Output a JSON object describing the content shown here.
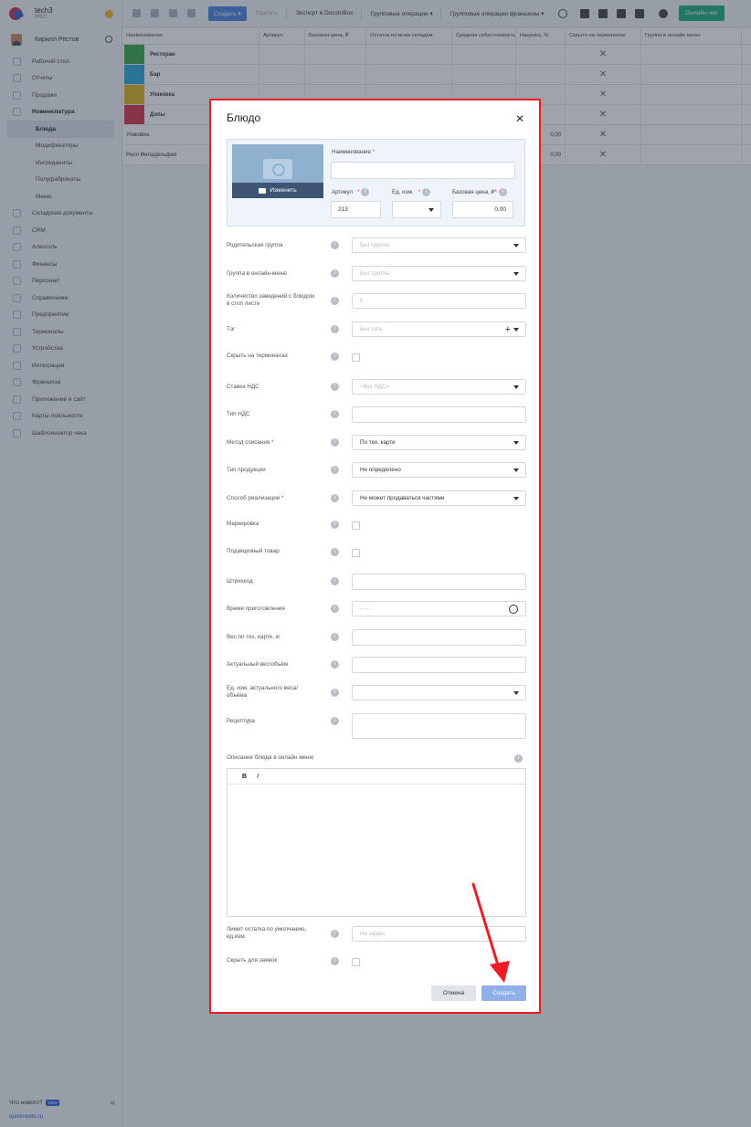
{
  "brand": {
    "name": "tech3",
    "plan": "PRO"
  },
  "user": {
    "name": "Кирилл Рестов"
  },
  "sidebar": {
    "items": [
      {
        "label": "Рабочий стол",
        "type": "top"
      },
      {
        "label": "Отчеты",
        "type": "top"
      },
      {
        "label": "Продажи",
        "type": "top"
      },
      {
        "label": "Номенклатура",
        "type": "open"
      },
      {
        "label": "Блюда",
        "type": "active"
      },
      {
        "label": "Модификаторы",
        "type": "sub"
      },
      {
        "label": "Ингредиенты",
        "type": "sub"
      },
      {
        "label": "Полуфабрикаты",
        "type": "sub"
      },
      {
        "label": "Меню",
        "type": "sub"
      },
      {
        "label": "Складские документы",
        "type": "top"
      },
      {
        "label": "CRM",
        "type": "top"
      },
      {
        "label": "Алкоголь",
        "type": "top"
      },
      {
        "label": "Финансы",
        "type": "top"
      },
      {
        "label": "Персонал",
        "type": "top"
      },
      {
        "label": "Справочники",
        "type": "top"
      },
      {
        "label": "Предприятие",
        "type": "top"
      },
      {
        "label": "Терминалы",
        "type": "top"
      },
      {
        "label": "Устройства",
        "type": "top"
      },
      {
        "label": "Интеграции",
        "type": "top"
      },
      {
        "label": "Франшиза",
        "type": "top"
      },
      {
        "label": "Приложение и сайт",
        "type": "top"
      },
      {
        "label": "Карты лояльности",
        "type": "top"
      },
      {
        "label": "Шаблонизатор чека",
        "type": "top"
      }
    ],
    "whats_new": "Что нового?",
    "new_badge": "NEW",
    "site_link": "quickresto.ru"
  },
  "toolbar": {
    "create_label": "Создать ▾",
    "delete_label": "Удалить",
    "export_label": "Экспорт в DocsInBox",
    "group_ops_label": "Групповые операции ▾",
    "franchise_ops_label": "Групповые операции франшизы ▾",
    "chat_label": "Онлайн-чат"
  },
  "table": {
    "headers": [
      "Наименование",
      "Артикул",
      "Базовая цена, ₽",
      "Остаток по всем складам",
      "Средняя себестоимость",
      "Наценка, %",
      "Скрыто на терминалах",
      "Группа в онлайн меню"
    ],
    "rows": [
      {
        "name": "Ресторан",
        "color": "#3aa845",
        "group": true,
        "markup": "",
        "hidden": true
      },
      {
        "name": "Бар",
        "color": "#27a9d6",
        "group": true,
        "markup": "",
        "hidden": true
      },
      {
        "name": "Упаковка",
        "color": "#e0b21b",
        "group": true,
        "markup": "",
        "hidden": true
      },
      {
        "name": "Допы",
        "color": "#d6364a",
        "group": true,
        "markup": "",
        "hidden": true
      },
      {
        "name": "Упаковка",
        "color": "",
        "group": false,
        "markup": "0,00",
        "hidden": true
      },
      {
        "name": "Ролл Филадельфия",
        "color": "",
        "group": false,
        "markup": "0,00",
        "hidden": true
      }
    ]
  },
  "modal": {
    "title": "Блюдо",
    "change_photo": "Изменить",
    "name_label": "Наименование",
    "article_label": "Артикул",
    "article_value": "213",
    "unit_label": "Ед. изм.",
    "price_label": "Базовая цена, ₽",
    "price_value": "0,00",
    "fields": {
      "parent_group": {
        "label": "Родительская группа",
        "value": "Без группы"
      },
      "online_group": {
        "label": "Группа в онлайн-меню",
        "value": "Без группы"
      },
      "stoplist": {
        "label": "Количество заведений с блюдом в стоп листе",
        "value": "0"
      },
      "tag": {
        "label": "Тэг",
        "value": "Без тэга"
      },
      "hide_terminals": {
        "label": "Скрыть на терминалах"
      },
      "vat_rate": {
        "label": "Ставка НДС",
        "value": "<без НДС>"
      },
      "vat_type": {
        "label": "Тип НДС",
        "value": ""
      },
      "writeoff": {
        "label": "Метод списания",
        "value": "По тех. карте"
      },
      "product_type": {
        "label": "Тип продукции",
        "value": "Не определено"
      },
      "sale_method": {
        "label": "Способ реализации",
        "value": "Не может продаваться частями"
      },
      "marking": {
        "label": "Маркировка"
      },
      "excise": {
        "label": "Подакцизный товар"
      },
      "barcode": {
        "label": "Штрихкод",
        "value": ""
      },
      "cook_time": {
        "label": "Время приготовления",
        "value": "--:--"
      },
      "weight": {
        "label": "Вес по тех. карте, кг",
        "value": ""
      },
      "actual_weight": {
        "label": "Актуальный вес/объём",
        "value": ""
      },
      "actual_unit": {
        "label": "Ед. изм. актуального веса/объёма",
        "value": ""
      },
      "recipe": {
        "label": "Рецептура",
        "value": ""
      },
      "description": {
        "label": "Описание блюда в онлайн меню"
      },
      "stock_limit": {
        "label": "Лимит остатка по умолчанию, ед.изм.",
        "value": "Не задан"
      },
      "hide_orders": {
        "label": "Скрыть для заявок"
      }
    },
    "bold_label": "B",
    "italic_label": "I",
    "cancel_label": "Отмена",
    "submit_label": "Создать"
  },
  "colors": {
    "accent": "#4e82e1",
    "chat": "#1fae7d",
    "highlight": "#ee1c25"
  }
}
